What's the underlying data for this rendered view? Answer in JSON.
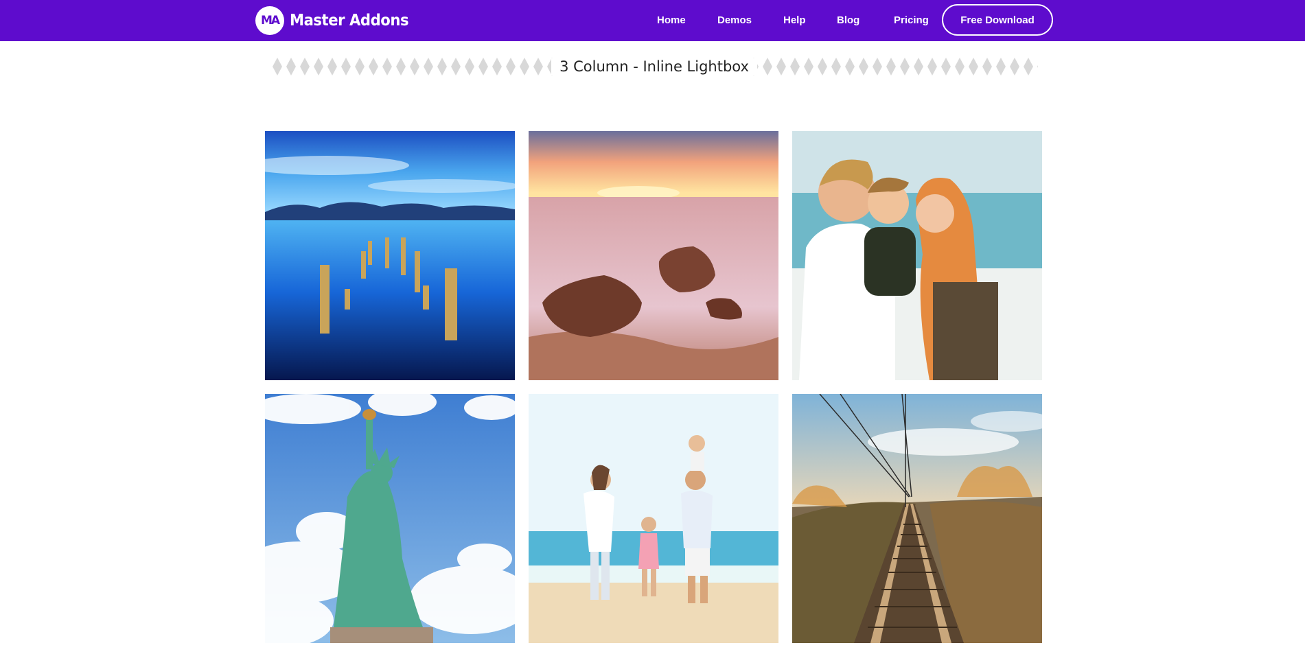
{
  "brand": {
    "name": "Master Addons",
    "badge": "MA"
  },
  "nav": {
    "items": [
      {
        "label": "Home"
      },
      {
        "label": "Demos"
      },
      {
        "label": "Help"
      },
      {
        "label": "Blog"
      },
      {
        "label": "Pricing"
      }
    ],
    "cta_label": "Free Download"
  },
  "section": {
    "title": "3 Column - Inline Lightbox"
  },
  "gallery": {
    "items": [
      {
        "subject": "lake-pier-posts"
      },
      {
        "subject": "sunset-beach-rocks"
      },
      {
        "subject": "family-kiss-beach"
      },
      {
        "subject": "statue-of-liberty"
      },
      {
        "subject": "family-walking-beach"
      },
      {
        "subject": "railway-tracks"
      }
    ]
  },
  "colors": {
    "brand": "#5e0ccd",
    "pattern": "#d8d8d8"
  }
}
